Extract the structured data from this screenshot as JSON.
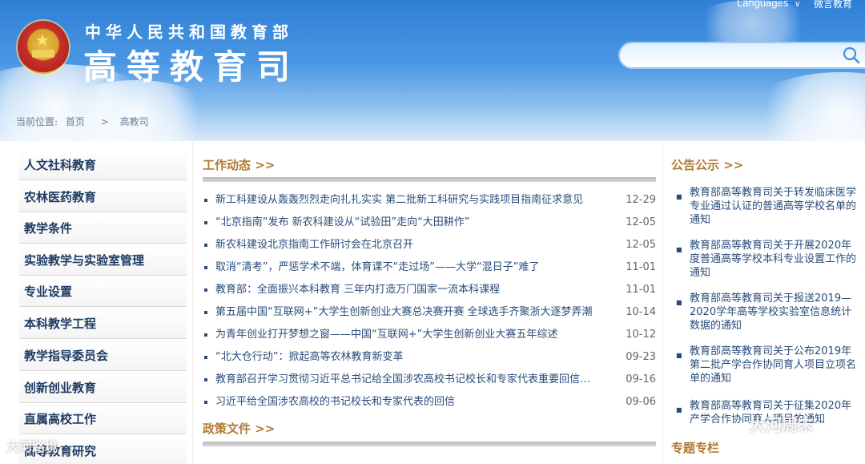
{
  "header": {
    "org_name": "中华人民共和国教育部",
    "dept_name": "高等教育司",
    "languages_label": "Languages",
    "weibo_label": "微言教育",
    "search_placeholder": ""
  },
  "breadcrumb": {
    "prefix": "当前位置:",
    "home": "首页",
    "sep": ">",
    "current": "高教司"
  },
  "sidebar": {
    "items": [
      {
        "label": "人文社科教育"
      },
      {
        "label": "农林医药教育"
      },
      {
        "label": "教学条件"
      },
      {
        "label": "实验教学与实验室管理"
      },
      {
        "label": "专业设置"
      },
      {
        "label": "本科教学工程"
      },
      {
        "label": "教学指导委员会"
      },
      {
        "label": "创新创业教育"
      },
      {
        "label": "直属高校工作"
      },
      {
        "label": "高等教育研究"
      }
    ]
  },
  "work_news": {
    "title": "工作动态 >>",
    "items": [
      {
        "title": "新工科建设从轰轰烈烈走向扎扎实实 第二批新工科研究与实践项目指南征求意见",
        "date": "12-29"
      },
      {
        "title": "“北京指南”发布 新农科建设从“试验田”走向“大田耕作”",
        "date": "12-05"
      },
      {
        "title": "新农科建设北京指南工作研讨会在北京召开",
        "date": "12-05"
      },
      {
        "title": "取消“清考”，严惩学术不端，体育课不“走过场”——大学“混日子”难了",
        "date": "11-01"
      },
      {
        "title": "教育部：全面振兴本科教育 三年内打造万门国家一流本科课程",
        "date": "11-01"
      },
      {
        "title": "第五届中国“互联网+”大学生创新创业大赛总决赛开赛 全球选手齐聚浙大逐梦弄潮",
        "date": "10-14"
      },
      {
        "title": "为青年创业打开梦想之窗——中国“互联网+”大学生创新创业大赛五年综述",
        "date": "10-12"
      },
      {
        "title": "“北大仓行动”：掀起高等农林教育新变革",
        "date": "09-23"
      },
      {
        "title": "教育部召开学习贯彻习近平总书记给全国涉农高校书记校长和专家代表重要回信精...",
        "date": "09-16"
      },
      {
        "title": "习近平给全国涉农高校的书记校长和专家代表的回信",
        "date": "09-06"
      }
    ]
  },
  "policy": {
    "title": "政策文件 >>"
  },
  "notices": {
    "title": "公告公示 >>",
    "items": [
      {
        "text": "教育部高等教育司关于转发临床医学专业通过认证的普通高等学校名单的通知"
      },
      {
        "text": "教育部高等教育司关于开展2020年度普通高等学校本科专业设置工作的通知"
      },
      {
        "text": "教育部高等教育司关于报送2019—2020学年高等学校实验室信息统计数据的通知"
      },
      {
        "text": "教育部高等教育司关于公布2019年第二批产学合作协同育人项目立项名单的通知"
      },
      {
        "text": "教育部高等教育司关于征集2020年产学合作协同育人项目的通知"
      }
    ]
  },
  "special": {
    "title": "专题专栏"
  },
  "watermarks": {
    "left": "大河路境",
    "right": "大河周末"
  }
}
